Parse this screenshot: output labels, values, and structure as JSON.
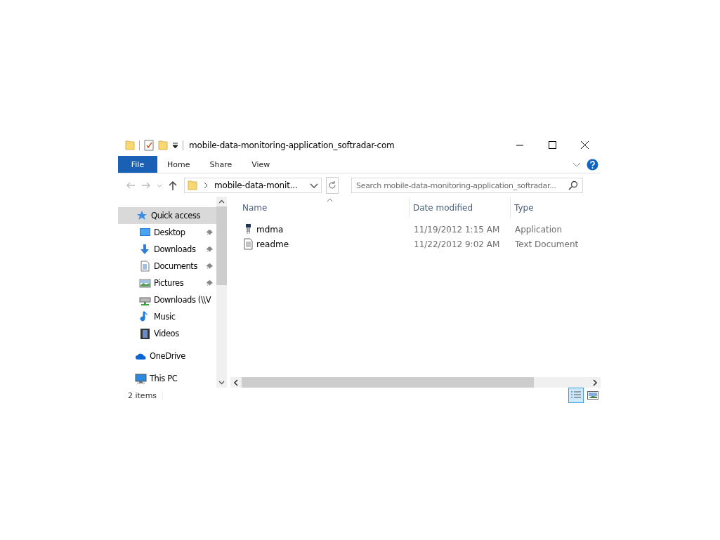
{
  "window": {
    "title": "mobile-data-monitoring-application_softradar-com"
  },
  "ribbon_tabs": [
    {
      "label": "File",
      "kind": "file",
      "selected": false
    },
    {
      "label": "Home",
      "kind": "tab",
      "selected": false
    },
    {
      "label": "Share",
      "kind": "tab",
      "selected": false
    },
    {
      "label": "View",
      "kind": "tab",
      "selected": false
    }
  ],
  "address": {
    "path": "mobile-data-monit...",
    "search_placeholder": "Search mobile-data-monitoring-application_softradar..."
  },
  "sidebar": {
    "items": [
      {
        "label": "Quick access",
        "kind": "star",
        "selected": true,
        "children": [
          {
            "label": "Desktop",
            "kind": "desktop",
            "pinned": true,
            "selected": false
          },
          {
            "label": "Downloads",
            "kind": "download",
            "pinned": true,
            "selected": false
          },
          {
            "label": "Documents",
            "kind": "documents",
            "pinned": true,
            "selected": false
          },
          {
            "label": "Pictures",
            "kind": "pictures",
            "pinned": true,
            "selected": false
          },
          {
            "label": "Downloads (\\\\V",
            "kind": "network",
            "pinned": false,
            "selected": false
          },
          {
            "label": "Music",
            "kind": "music",
            "pinned": false,
            "selected": false
          },
          {
            "label": "Videos",
            "kind": "videos",
            "pinned": false,
            "selected": false
          }
        ]
      },
      {
        "label": "OneDrive",
        "kind": "cloud",
        "selected": false
      },
      {
        "label": "This PC",
        "kind": "pc",
        "selected": false
      }
    ]
  },
  "table": {
    "columns": [
      {
        "label": "Name",
        "sorted": true
      },
      {
        "label": "Date modified",
        "sorted": false
      },
      {
        "label": "Type",
        "sorted": false
      }
    ],
    "rows": [
      {
        "name": "mdma",
        "kind": "app",
        "date": "11/19/2012 1:15 AM",
        "type": "Application"
      },
      {
        "name": "readme",
        "kind": "text",
        "date": "11/22/2012 9:02 AM",
        "type": "Text Document"
      }
    ]
  },
  "status_bar": {
    "count": "2 items",
    "views": [
      {
        "kind": "details",
        "selected": true
      },
      {
        "kind": "large",
        "selected": false
      }
    ]
  }
}
